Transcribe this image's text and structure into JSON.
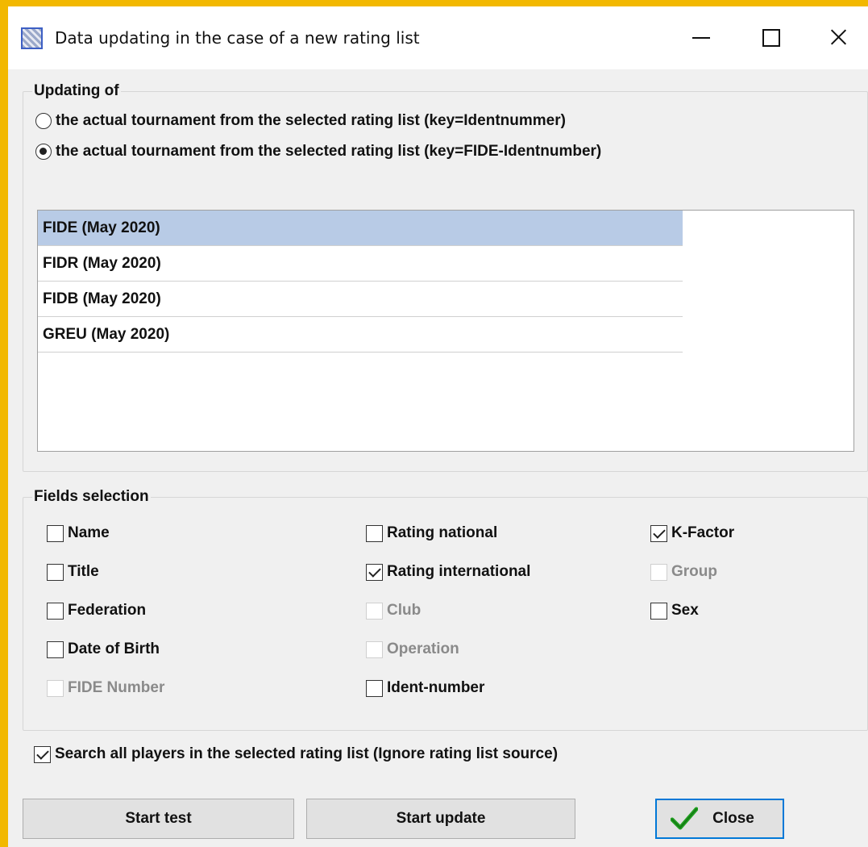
{
  "window": {
    "title": "Data updating in the case of a new rating list",
    "icon": "app-icon"
  },
  "updating": {
    "title": "Updating of",
    "options": [
      {
        "label": "the actual tournament from the selected rating list (key=Identnummer)",
        "checked": false
      },
      {
        "label": "the actual tournament from the selected rating list (key=FIDE-Identnumber)",
        "checked": true
      }
    ],
    "rating_lists": [
      {
        "label": "FIDE (May 2020)",
        "selected": true
      },
      {
        "label": "FIDR (May 2020)",
        "selected": false
      },
      {
        "label": "FIDB (May 2020)",
        "selected": false
      },
      {
        "label": "GREU (May 2020)",
        "selected": false
      }
    ]
  },
  "fields": {
    "title": "Fields selection",
    "items": [
      {
        "label": "Name",
        "checked": false,
        "enabled": true
      },
      {
        "label": "Title",
        "checked": false,
        "enabled": true
      },
      {
        "label": "Federation",
        "checked": false,
        "enabled": true
      },
      {
        "label": "Date of Birth",
        "checked": false,
        "enabled": true
      },
      {
        "label": "FIDE Number",
        "checked": false,
        "enabled": false
      },
      {
        "label": "Rating national",
        "checked": false,
        "enabled": true
      },
      {
        "label": "Rating international",
        "checked": true,
        "enabled": true
      },
      {
        "label": "Club",
        "checked": false,
        "enabled": false
      },
      {
        "label": "Operation",
        "checked": false,
        "enabled": false
      },
      {
        "label": "Ident-number",
        "checked": false,
        "enabled": true
      },
      {
        "label": "K-Factor",
        "checked": true,
        "enabled": true
      },
      {
        "label": "Group",
        "checked": false,
        "enabled": false
      },
      {
        "label": "Sex",
        "checked": false,
        "enabled": true
      }
    ]
  },
  "search_all": {
    "label": "Search all players in the selected rating list (Ignore rating list source)",
    "checked": true
  },
  "buttons": {
    "start_test": "Start test",
    "start_update": "Start update",
    "close": "Close"
  },
  "colors": {
    "accent_border": "#f2b800",
    "selection": "#b8cbe6",
    "focus": "#0078d7",
    "check_green": "#1f9e1f"
  }
}
